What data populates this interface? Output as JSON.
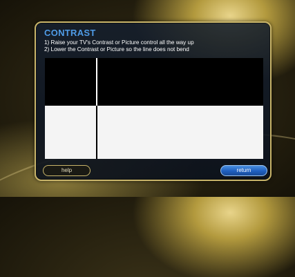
{
  "screen": {
    "title": "CONTRAST",
    "instructions": [
      "1) Raise your TV's Contrast or Picture control all the way up",
      "2) Lower the Contrast or Picture so the line does not bend"
    ]
  },
  "test_pattern": {
    "top_color": "#000000",
    "bottom_color": "#f4f4f4",
    "line_color": "#ffffff"
  },
  "buttons": {
    "help_label": "help",
    "return_label": "return"
  },
  "colors": {
    "title": "#4f9be6",
    "frame_border": "#c9b56a",
    "return_button": "#1f5fbf"
  }
}
